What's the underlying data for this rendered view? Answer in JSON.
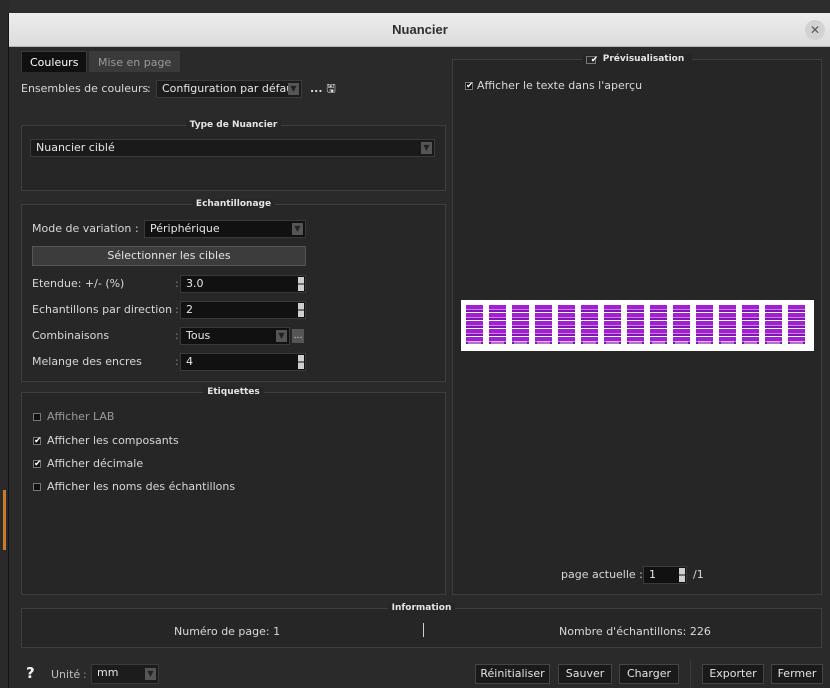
{
  "window": {
    "title": "Nuancier"
  },
  "tabs": [
    {
      "label": "Couleurs",
      "active": true
    },
    {
      "label": "Mise en page",
      "active": false
    }
  ],
  "color_sets": {
    "label": "Ensembles de couleurs",
    "separator": ":",
    "value": "Configuration par défaut",
    "browse_label": "...",
    "save_icon": "floppy-icon"
  },
  "type_section": {
    "title": "Type de Nuancier",
    "value": "Nuancier ciblé"
  },
  "sampling": {
    "title": "Echantillonage",
    "mode_label": "Mode de variation",
    "mode_sep": ":",
    "mode_value": "Périphérique",
    "select_targets_label": "Sélectionner les cibles",
    "rows": [
      {
        "label": "Etendue: +/- (%)",
        "sep": ":",
        "value": "3.0",
        "kind": "spin"
      },
      {
        "label": "Echantillons par direction",
        "sep": ":",
        "value": "2",
        "kind": "spin"
      },
      {
        "label": "Combinaisons",
        "sep": ":",
        "value": "Tous",
        "kind": "combo"
      },
      {
        "label": "Melange des encres",
        "sep": ":",
        "value": "4",
        "kind": "spin"
      }
    ]
  },
  "labels_section": {
    "title": "Etiquettes",
    "options": [
      {
        "label": "Afficher LAB",
        "checked": false
      },
      {
        "label": "Afficher les composants",
        "checked": true
      },
      {
        "label": "Afficher décimale",
        "checked": true
      },
      {
        "label": "Afficher les noms des échantillons",
        "checked": false
      }
    ]
  },
  "preview": {
    "title": "Prévisualisation",
    "title_checked": true,
    "show_text_label": "Afficher le texte dans l'aperçu",
    "show_text_checked": true,
    "swatch_color": "#a21fd6",
    "swatch_count": 15,
    "page_label": "page actuelle :",
    "page_value": "1",
    "page_total": "/1"
  },
  "information": {
    "title": "Information",
    "page_number": "Numéro de page: 1",
    "sample_count": "Nombre d'échantillons: 226"
  },
  "footer": {
    "help": "?",
    "unit_label": "Unité",
    "unit_sep": ":",
    "unit_value": "mm",
    "buttons": {
      "reset": "Réinitialiser",
      "save": "Sauver",
      "load": "Charger",
      "export": "Exporter",
      "close": "Fermer"
    }
  }
}
